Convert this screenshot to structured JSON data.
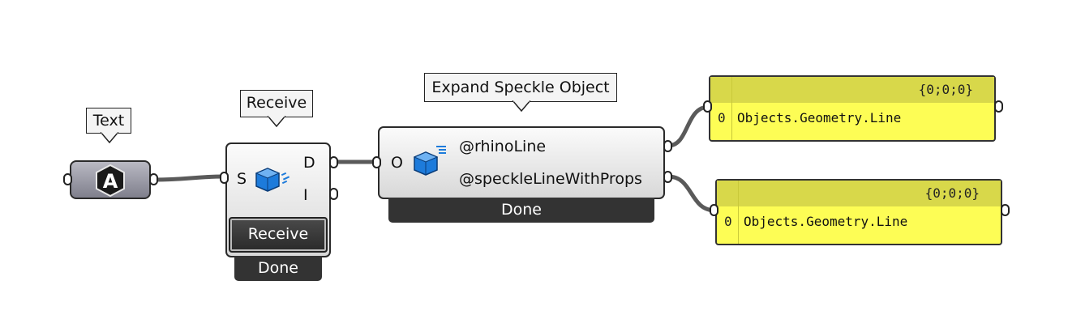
{
  "text_param": {
    "tooltip": "Text",
    "icon": "letter-a-hexagon-icon"
  },
  "receive": {
    "tooltip": "Receive",
    "input_S": "S",
    "output_D": "D",
    "output_I": "I",
    "button_label": "Receive",
    "status": "Done",
    "icon": "speckle-receive-cube-icon"
  },
  "expand": {
    "tooltip": "Expand Speckle Object",
    "input_O": "O",
    "output_1": "@rhinoLine",
    "output_2": "@speckleLineWithProps",
    "status": "Done",
    "icon": "speckle-expand-cube-icon"
  },
  "panel1": {
    "path": "{0;0;0}",
    "index": "0",
    "value": "Objects.Geometry.Line"
  },
  "panel2": {
    "path": "{0;0;0}",
    "index": "0",
    "value": "Objects.Geometry.Line"
  },
  "colors": {
    "panel_yellow": "#fdfd55",
    "panel_header": "#d8d84a",
    "speckle_blue": "#1d7bdb",
    "wire": "#5a5a5a"
  }
}
